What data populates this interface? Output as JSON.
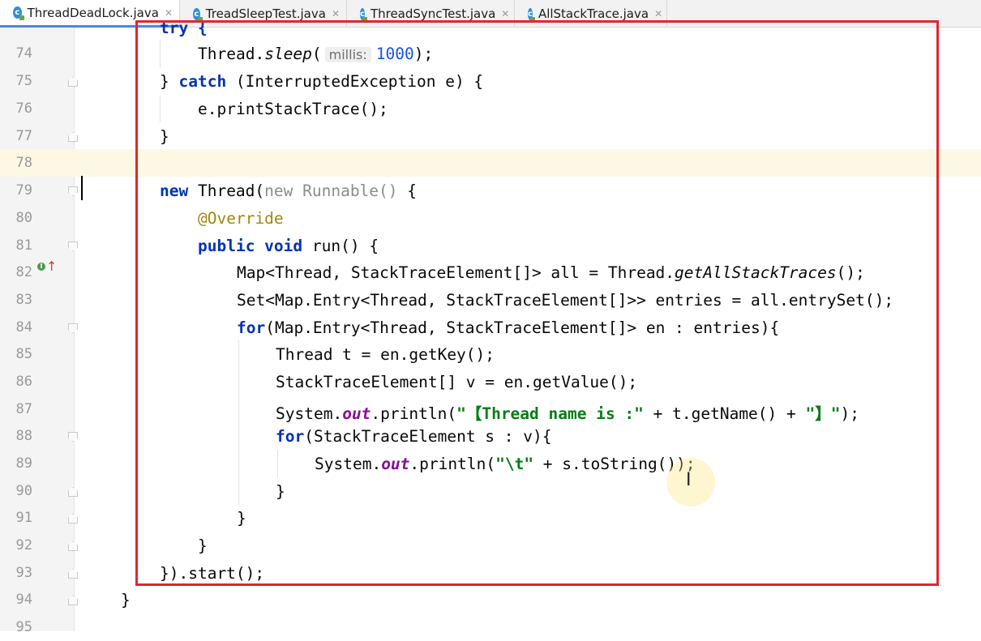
{
  "tabs": [
    {
      "name": "ThreadDeadLock.java",
      "active": true
    },
    {
      "name": "TreadSleepTest.java",
      "active": false
    },
    {
      "name": "ThreadSyncTest.java",
      "active": false
    },
    {
      "name": "AllStackTrace.java",
      "active": false
    }
  ],
  "icons": {
    "file": "java-class-icon",
    "close": "close-icon",
    "override": "override-method-icon",
    "fold": "fold-marker-icon"
  },
  "colors": {
    "keyword": "#0033b3",
    "string": "#067d17",
    "number": "#1750eb",
    "annotation": "#9e880d",
    "field": "#871094",
    "highlight_frame": "#e2262f"
  },
  "partial_top_line": "try {",
  "lines": [
    {
      "num": "74",
      "parts": {
        "p1": "Thread.",
        "p2": "sleep",
        "p3": "(",
        "hint": "millis:",
        "p4": "1000",
        "p5": ");"
      }
    },
    {
      "num": "75",
      "parts": {
        "p1": "} ",
        "p2": "catch",
        "p3": " (InterruptedException e) {"
      }
    },
    {
      "num": "76",
      "parts": {
        "p1": "e.printStackTrace();"
      }
    },
    {
      "num": "77",
      "parts": {
        "p1": "}"
      }
    },
    {
      "num": "78",
      "parts": {}
    },
    {
      "num": "79",
      "parts": {
        "p1": "new",
        "p2": " Thread(",
        "p3": "new Runnable()",
        "p4": " {"
      }
    },
    {
      "num": "80",
      "parts": {
        "p1": "@Override"
      }
    },
    {
      "num": "81",
      "parts": {
        "p1": "public void",
        "p2": " run() {"
      }
    },
    {
      "num": "82",
      "parts": {
        "p1": "Map<Thread, StackTraceElement[]> all = Thread.",
        "p2": "getAllStackTraces",
        "p3": "();"
      }
    },
    {
      "num": "83",
      "parts": {
        "p1": "Set<Map.Entry<Thread, StackTraceElement[]>> entries = all.entrySet();"
      }
    },
    {
      "num": "84",
      "parts": {
        "p1": "for",
        "p2": "(Map.Entry<Thread, StackTraceElement[]> en : entries){"
      }
    },
    {
      "num": "85",
      "parts": {
        "p1": "Thread t = en.getKey();"
      }
    },
    {
      "num": "86",
      "parts": {
        "p1": "StackTraceElement[] v = en.getValue();"
      }
    },
    {
      "num": "87",
      "parts": {
        "p1": "System.",
        "p2": "out",
        "p3": ".println(",
        "p4": "\"【Thread name is :\"",
        "p5": " + t.getName() + ",
        "p6": "\"】\"",
        "p7": ");"
      }
    },
    {
      "num": "88",
      "parts": {
        "p1": "for",
        "p2": "(StackTraceElement s : v){"
      }
    },
    {
      "num": "89",
      "parts": {
        "p1": "System.",
        "p2": "out",
        "p3": ".println(",
        "p4": "\"\\t\"",
        "p5": " + s.toString());"
      }
    },
    {
      "num": "90",
      "parts": {
        "p1": "}"
      }
    },
    {
      "num": "91",
      "parts": {
        "p1": "}"
      }
    },
    {
      "num": "92",
      "parts": {
        "p1": "}"
      }
    },
    {
      "num": "93",
      "parts": {
        "p1": "}).start();"
      }
    },
    {
      "num": "94",
      "parts": {
        "p1": "}"
      }
    },
    {
      "num": "95",
      "parts": {}
    }
  ]
}
